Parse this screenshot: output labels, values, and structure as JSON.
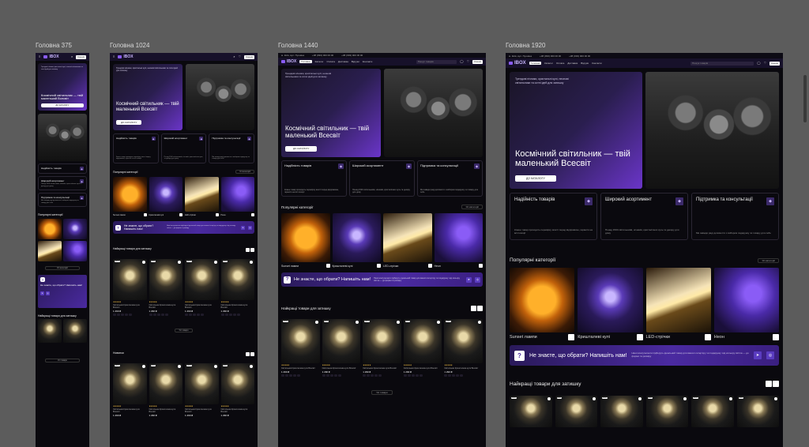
{
  "labels": {
    "f375": "Головна 375",
    "f1024": "Головна 1024",
    "f1440": "Головна 1440",
    "f1920": "Головна 1920"
  },
  "brand": "IBOX",
  "nav": {
    "links": [
      "Головна",
      "Каталог",
      "Оплата",
      "Доставка",
      "Відгуки",
      "Контакти"
    ],
    "search_placeholder": "Пошук товарів",
    "cart": "Кошик"
  },
  "topbar": {
    "items": [
      "м. Київ, вул. Пушкіна",
      "+38 (093) 000 00 00",
      "+38 (093) 000 00 00"
    ]
  },
  "hero": {
    "title": "Космічний світильник — твій маленький Всесвіт",
    "subtitle": "Трендові нічники, кристальні кулі, неонові світильники та сотні ідей для затишку",
    "cta": "ДО КАТАЛОГУ"
  },
  "features": [
    {
      "title": "Надійність товарів",
      "text": "Кожен товар проходить перевірку якості перед відправкою, гарантія на всі позиції"
    },
    {
      "title": "Широкий асортимент",
      "text": "Понад 1500 світильників, нічників, кристалічних куль та декору для дому"
    },
    {
      "title": "Підтримка та консультації",
      "text": "Ми завжди раді допомогти з вибором подарунку чи товару для себе"
    }
  ],
  "categories": {
    "title": "Популярні категорії",
    "all": "Усі категорії",
    "items": [
      "Sunset лампи",
      "Кришталеві кулі",
      "LED-стрічки",
      "Неон"
    ]
  },
  "banner": {
    "title": "Не знаєте, що обрати? Напишіть нам!",
    "text": "Наші консультанти підберуть ідеальний товар для вашого інтер'єру чи подарунку: від кольору світла — до форми та розміру"
  },
  "products": {
    "title": "Найкращі товари для затишку",
    "more": "Усі товари",
    "badge": "NEW",
    "name": "Світильник Кришталева куля Всесвіт",
    "stars": "★★★★★",
    "price": "1 290 ₴",
    "rating_count": "(12)"
  },
  "news": {
    "title": "Новинки"
  }
}
